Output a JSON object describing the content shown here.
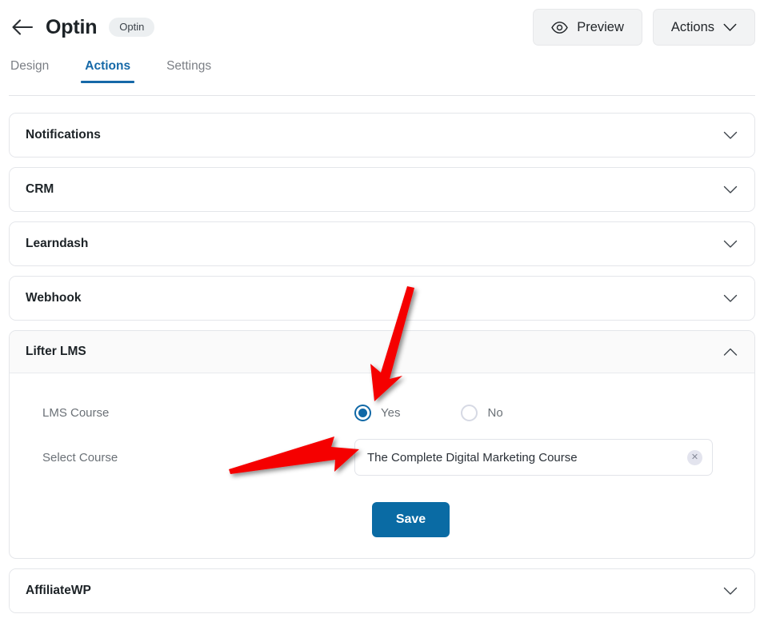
{
  "header": {
    "back_icon": "back-arrow-icon",
    "title": "Optin",
    "badge": "Optin",
    "preview_label": "Preview",
    "preview_icon": "eye-icon",
    "actions_label": "Actions",
    "actions_icon": "chevron-down-icon"
  },
  "tabs": [
    {
      "label": "Design",
      "active": false
    },
    {
      "label": "Actions",
      "active": true
    },
    {
      "label": "Settings",
      "active": false
    }
  ],
  "accordions": [
    {
      "title": "Notifications",
      "open": false,
      "chevron": "chevron-down-icon"
    },
    {
      "title": "CRM",
      "open": false,
      "chevron": "chevron-down-icon"
    },
    {
      "title": "Learndash",
      "open": false,
      "chevron": "chevron-down-icon"
    },
    {
      "title": "Webhook",
      "open": false,
      "chevron": "chevron-down-icon"
    },
    {
      "title": "Lifter LMS",
      "open": true,
      "chevron": "chevron-up-icon"
    },
    {
      "title": "AffiliateWP",
      "open": false,
      "chevron": "chevron-down-icon"
    }
  ],
  "lifter_lms": {
    "lms_course_label": "LMS Course",
    "radio_yes": "Yes",
    "radio_no": "No",
    "selected_radio": "Yes",
    "select_course_label": "Select Course",
    "select_course_value": "The Complete Digital Marketing Course",
    "clear_icon": "close-icon",
    "save_label": "Save"
  },
  "colors": {
    "accent_blue": "#1669a8",
    "primary_button": "#0a6ba4",
    "radio_selected": "#1068a6",
    "annotation_red": "#f50000",
    "card_border": "#e4e6ea",
    "muted_text": "#6b7177"
  },
  "annotations": [
    {
      "name": "arrow-to-yes-radio",
      "color": "#f50000",
      "direction": "down-left"
    },
    {
      "name": "arrow-to-select-course",
      "color": "#f50000",
      "direction": "right"
    }
  ]
}
